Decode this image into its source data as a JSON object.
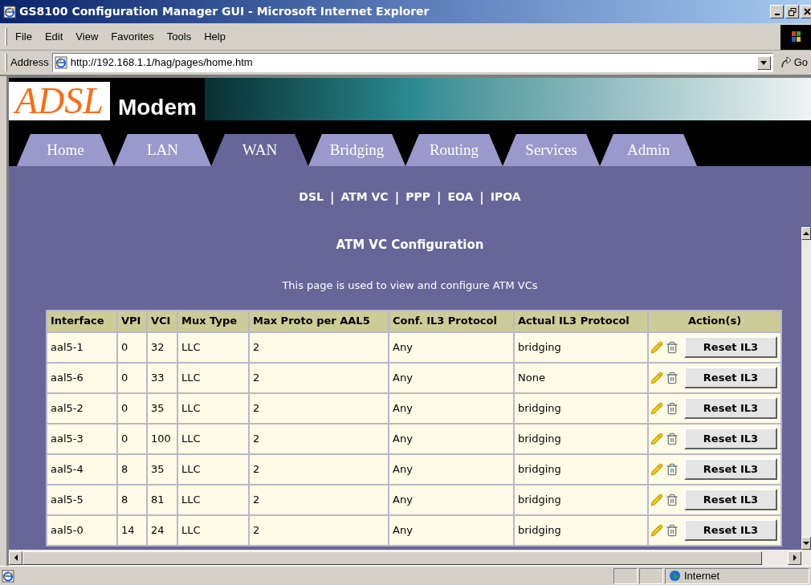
{
  "window": {
    "title": "GS8100 Configuration Manager GUI - Microsoft Internet Explorer"
  },
  "menu": [
    "File",
    "Edit",
    "View",
    "Favorites",
    "Tools",
    "Help"
  ],
  "address": {
    "label": "Address",
    "url": "http://192.168.1.1/hag/pages/home.htm",
    "go": "Go"
  },
  "header": {
    "logo": "ADSL",
    "title": "Modem"
  },
  "tabs": [
    {
      "label": "Home",
      "selected": false
    },
    {
      "label": "LAN",
      "selected": false
    },
    {
      "label": "WAN",
      "selected": true
    },
    {
      "label": "Bridging",
      "selected": false
    },
    {
      "label": "Routing",
      "selected": false
    },
    {
      "label": "Services",
      "selected": false
    },
    {
      "label": "Admin",
      "selected": false
    }
  ],
  "sub_nav": [
    {
      "kind": "link",
      "label": "DSL"
    },
    {
      "kind": "separator",
      "label": "|"
    },
    {
      "kind": "link",
      "label": "ATM VC"
    },
    {
      "kind": "separator",
      "label": "|"
    },
    {
      "kind": "link",
      "label": "PPP"
    },
    {
      "kind": "separator",
      "label": "|"
    },
    {
      "kind": "link",
      "label": "EOA"
    },
    {
      "kind": "separator",
      "label": "|"
    },
    {
      "kind": "link",
      "label": "IPOA"
    }
  ],
  "section_title": "ATM VC Configuration",
  "description": "This page is used to view and configure ATM VCs",
  "table": {
    "columns": [
      "Interface",
      "VPI",
      "VCI",
      "Mux Type",
      "Max Proto per AAL5",
      "Conf. IL3 Protocol",
      "Actual IL3 Protocol",
      "Action(s)"
    ],
    "rows": [
      {
        "cells": [
          "aal5-1",
          "0",
          "32",
          "LLC",
          "2",
          "Any",
          "bridging"
        ],
        "action": "Reset IL3"
      },
      {
        "cells": [
          "aal5-6",
          "0",
          "33",
          "LLC",
          "2",
          "Any",
          "None"
        ],
        "action": "Reset IL3"
      },
      {
        "cells": [
          "aal5-2",
          "0",
          "35",
          "LLC",
          "2",
          "Any",
          "bridging"
        ],
        "action": "Reset IL3"
      },
      {
        "cells": [
          "aal5-3",
          "0",
          "100",
          "LLC",
          "2",
          "Any",
          "bridging"
        ],
        "action": "Reset IL3"
      },
      {
        "cells": [
          "aal5-4",
          "8",
          "35",
          "LLC",
          "2",
          "Any",
          "bridging"
        ],
        "action": "Reset IL3"
      },
      {
        "cells": [
          "aal5-5",
          "8",
          "81",
          "LLC",
          "2",
          "Any",
          "bridging"
        ],
        "action": "Reset IL3"
      },
      {
        "cells": [
          "aal5-0",
          "14",
          "24",
          "LLC",
          "2",
          "Any",
          "bridging"
        ],
        "action": "Reset IL3"
      }
    ]
  },
  "status_bar": {
    "zone": "Internet"
  }
}
